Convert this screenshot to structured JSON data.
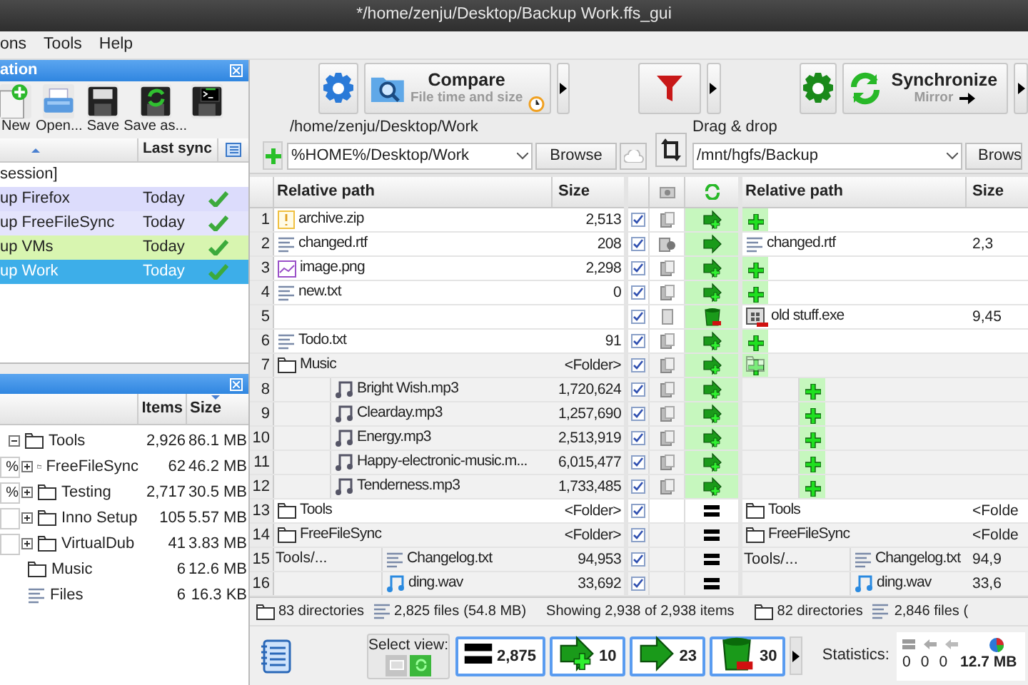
{
  "window": {
    "title": "*/home/zenju/Desktop/Backup Work.ffs_gui"
  },
  "menu": [
    {
      "label": "ons"
    },
    {
      "label": "Tools"
    },
    {
      "label": "Help"
    }
  ],
  "config_panel": {
    "title": "ation",
    "tools": [
      {
        "kind": "new",
        "label": "New"
      },
      {
        "kind": "open",
        "label": "Open..."
      },
      {
        "kind": "save",
        "label": "Save"
      },
      {
        "kind": "save_as",
        "label": "Save as..."
      },
      {
        "kind": "save_batch"
      }
    ],
    "column": "Last sync",
    "rows": [
      {
        "name": "session]",
        "selected": false
      },
      {
        "name": "up Firefox",
        "last_sync": "Today",
        "color": "#dcdcfc",
        "selected": false
      },
      {
        "name": "up FreeFileSync",
        "last_sync": "Today",
        "color": "#e4e4fc",
        "selected": false
      },
      {
        "name": "up VMs",
        "last_sync": "Today",
        "color": "#d8f5b0",
        "selected": false
      },
      {
        "name": "up Work",
        "last_sync": "Today",
        "selected": true
      }
    ]
  },
  "overview_panel": {
    "columns": [
      "Items",
      "Size"
    ],
    "rows": [
      {
        "kind": "folder",
        "name": "Tools",
        "items": "2,926",
        "size": "86.1 MB",
        "expanded": true,
        "children": [
          {
            "kind": "folder",
            "name": "FreeFileSync",
            "items": "62",
            "size": "46.2 MB",
            "percent": "%",
            "expanded": false
          },
          {
            "kind": "folder",
            "name": "Testing",
            "items": "2,717",
            "size": "30.5 MB",
            "percent": "%",
            "expanded": false
          },
          {
            "kind": "folder",
            "name": "Inno Setup",
            "items": "105",
            "size": "5.57 MB",
            "expanded": false
          },
          {
            "kind": "folder",
            "name": "VirtualDub",
            "items": "41",
            "size": "3.83 MB",
            "expanded": false
          }
        ]
      },
      {
        "kind": "folder",
        "name": "Music",
        "items": "6",
        "size": "12.6 MB"
      },
      {
        "kind": "files",
        "name": "Files",
        "items": "6",
        "size": "16.3 KB"
      }
    ]
  },
  "compare": {
    "title": "Compare",
    "subtitle": "File time and size"
  },
  "synchronize": {
    "title": "Synchronize",
    "subtitle": "Mirror"
  },
  "left_folder": {
    "label": "/home/zenju/Desktop/Work",
    "value": "%HOME%/Desktop/Work",
    "browse": "Browse"
  },
  "right_folder": {
    "label": "Drag & drop",
    "value": "/mnt/hgfs/Backup",
    "browse": "Brows"
  },
  "grid": {
    "left_columns": [
      "Relative path",
      "Size"
    ],
    "right_columns": [
      "Relative path",
      "Size"
    ],
    "rows": [
      {
        "num": "1",
        "kind": "file",
        "left": {
          "kind": "archive",
          "name": "archive.zip",
          "size": "2,513"
        },
        "checked": true,
        "category": {
          "kind": "left_only"
        },
        "action": {
          "kind": "create"
        }
      },
      {
        "num": "2",
        "kind": "file",
        "left": {
          "kind": "text",
          "name": "changed.rtf",
          "size": "208"
        },
        "checked": true,
        "category": {
          "kind": "different"
        },
        "action": {
          "kind": "update"
        },
        "right": {
          "kind": "text",
          "name": "changed.rtf",
          "size": "2,3"
        }
      },
      {
        "num": "3",
        "kind": "file",
        "left": {
          "kind": "image",
          "name": "image.png",
          "size": "2,298"
        },
        "checked": true,
        "category": {
          "kind": "left_only"
        },
        "action": {
          "kind": "create"
        }
      },
      {
        "num": "4",
        "kind": "file",
        "left": {
          "kind": "text",
          "name": "new.txt",
          "size": "0"
        },
        "checked": true,
        "category": {
          "kind": "left_only"
        },
        "action": {
          "kind": "create"
        }
      },
      {
        "num": "5",
        "kind": "file",
        "checked": true,
        "category": {
          "kind": "right_only"
        },
        "action": {
          "kind": "delete"
        },
        "right": {
          "kind": "program",
          "name": "old stuff.exe",
          "size": "9,45"
        }
      },
      {
        "num": "6",
        "kind": "file",
        "left": {
          "kind": "text",
          "name": "Todo.txt",
          "size": "91"
        },
        "checked": true,
        "category": {
          "kind": "left_only"
        },
        "action": {
          "kind": "create"
        }
      },
      {
        "num": "7",
        "kind": "folder",
        "left": {
          "kind": "folder",
          "name": "Music",
          "size": "<Folder>"
        },
        "checked": true,
        "category": {
          "kind": "left_only"
        },
        "action": {
          "kind": "create"
        },
        "children": [
          {
            "num": "8",
            "kind": "file",
            "left": {
              "kind": "music",
              "name": "Bright Wish.mp3",
              "size": "1,720,624"
            },
            "checked": true,
            "category": {
              "kind": "left_only"
            },
            "action": {
              "kind": "create"
            }
          },
          {
            "num": "9",
            "kind": "file",
            "left": {
              "kind": "music",
              "name": "Clearday.mp3",
              "size": "1,257,690"
            },
            "checked": true,
            "category": {
              "kind": "left_only"
            },
            "action": {
              "kind": "create"
            }
          },
          {
            "num": "10",
            "kind": "file",
            "left": {
              "kind": "music",
              "name": "Energy.mp3",
              "size": "2,513,919"
            },
            "checked": true,
            "category": {
              "kind": "left_only"
            },
            "action": {
              "kind": "create"
            }
          },
          {
            "num": "11",
            "kind": "file",
            "left": {
              "kind": "music",
              "name": "Happy-electronic-music.m...",
              "size": "6,015,477"
            },
            "checked": true,
            "category": {
              "kind": "left_only"
            },
            "action": {
              "kind": "create"
            }
          },
          {
            "num": "12",
            "kind": "file",
            "left": {
              "kind": "music",
              "name": "Tenderness.mp3",
              "size": "1,733,485"
            },
            "checked": true,
            "category": {
              "kind": "left_only"
            },
            "action": {
              "kind": "create"
            }
          }
        ]
      },
      {
        "num": "13",
        "kind": "folder",
        "left": {
          "kind": "folder",
          "name": "Tools",
          "size": "<Folder>"
        },
        "checked": true,
        "action": {
          "kind": "equal"
        },
        "right": {
          "kind": "folder",
          "name": "Tools",
          "size": "<Folde"
        },
        "children": [
          {
            "num": "14",
            "kind": "folder",
            "left": {
              "kind": "folder",
              "name": "FreeFileSync",
              "size": "<Folder>"
            },
            "checked": true,
            "action": {
              "kind": "equal"
            },
            "right": {
              "kind": "folder",
              "name": "FreeFileSync",
              "size": "<Folde"
            },
            "children": [
              {
                "num": "15",
                "kind": "file",
                "left": {
                  "kind": "text",
                  "name": "Changelog.txt",
                  "size": "94,953",
                  "note": "Tools/..."
                },
                "checked": true,
                "action": {
                  "kind": "equal"
                },
                "right": {
                  "kind": "text",
                  "name": "Changelog.txt",
                  "size": "94,9",
                  "note": "Tools/..."
                }
              },
              {
                "num": "16",
                "kind": "file",
                "left": {
                  "kind": "audio",
                  "name": "ding.wav",
                  "size": "33,692"
                },
                "checked": true,
                "action": {
                  "kind": "equal"
                },
                "right": {
                  "kind": "audio",
                  "name": "ding.wav",
                  "size": "33,6"
                }
              }
            ]
          }
        ]
      }
    ]
  },
  "status": {
    "left_dirs": "83 directories",
    "left_files": "2,825 files",
    "left_size": "(54.8 MB)",
    "summary": "Showing 2,938 of 2,938 items",
    "right_dirs": "82 directories",
    "right_files": "2,846 files ("
  },
  "view_filter": {
    "label": "Select view:",
    "modes": [
      {
        "kind": "category",
        "selected": false
      },
      {
        "kind": "action",
        "selected": true
      }
    ]
  },
  "counts": [
    {
      "kind": "equal",
      "count": "2,875",
      "selected": true
    },
    {
      "kind": "create",
      "count": "10",
      "selected": true
    },
    {
      "kind": "update",
      "count": "23",
      "selected": true
    },
    {
      "kind": "delete",
      "count": "30",
      "selected": true
    }
  ],
  "statistics": {
    "label": "Statistics:",
    "values": [
      "0",
      "0",
      "0"
    ],
    "size": "12.7 MB"
  }
}
